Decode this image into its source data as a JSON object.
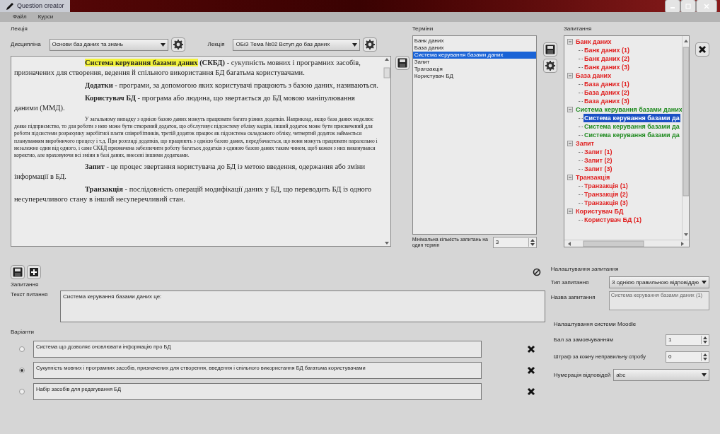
{
  "window": {
    "title": "Question creator"
  },
  "menu": [
    "Файл",
    "Курси"
  ],
  "lecture": {
    "title": "Лекція",
    "discipline_label": "Дисципліна",
    "discipline": "Основи баз даних та знань",
    "lecture_label": "Лекція",
    "lecture": "ОБіЗ Тема №02 Вступ до баз даних"
  },
  "editor": {
    "paragraphs": [
      {
        "kind": "term",
        "term": "Система керування базами даних",
        "highlight": true,
        "text": "**(СКБД)** - сукупність мовних і програмних засобів, призначених для створення, ведення й спільного використання БД багатьма користувачами."
      },
      {
        "kind": "term",
        "term": "Додатки",
        "highlight": false,
        "text": " - програми, за допомогою яких користувачі працюють з базою даних, називаються."
      },
      {
        "kind": "term",
        "term": "Користувач БД",
        "highlight": false,
        "text": " - програма або людина, що звертається до БД мовою маніпулювання даними (ММД)."
      },
      {
        "kind": "small",
        "text": "У загальному випадку з однією базою даних можуть працювати багато різних додатків. Наприклад, якщо база даних моделює деяке підприємство, то для роботи з нею може бути створений додаток, що обслуговує підсистему обліку кадрів, інший додаток може бути присвячений для роботи підсистеми розрахунку заробітної плати співробітників, третій додаток працює як підсистема складського обліку, четвертий додаток займається плануванням виробничого процесу і т.д. При розгляді додатків, що працюють з однією базою даних, передбачається, що вони можуть працювати паралельно і незалежно один від одного, і саме СКБД призначена забезпечити роботу багатьох додатків з єдиною базою даних таким чином, щоб кожен з них виконувався коректно, але враховуючи всі зміни в базі даних, внесені іншими додатками."
      },
      {
        "kind": "term",
        "term": "Запит",
        "highlight": false,
        "text": " - це процес звертання користувача до БД із метою введення, одержання або зміни інформації в БД."
      },
      {
        "kind": "term",
        "term": "Транзакція",
        "highlight": false,
        "text": " - послідовність операцій модифікації даних у БД, що переводить БД із одного несуперечливого стану в інший несуперечливий стан."
      }
    ]
  },
  "terms": {
    "title": "Терміни",
    "items": [
      {
        "label": "Банк даних",
        "selected": false
      },
      {
        "label": "База даних",
        "selected": false
      },
      {
        "label": "Система керування базами даних",
        "selected": true
      },
      {
        "label": "Запит",
        "selected": false
      },
      {
        "label": "Транзакція",
        "selected": false
      },
      {
        "label": "Користувач БД",
        "selected": false
      }
    ],
    "min_label": "Мінімальна кількість запитань на один термін",
    "min_value": "3"
  },
  "questions_tree": {
    "title": "Запитання",
    "items": [
      {
        "label": "Банк даних",
        "color": "#e02020",
        "selected": false,
        "children": [
          {
            "label": "Банк даних (1)",
            "color": "#e02020",
            "selected": false
          },
          {
            "label": "Банк даних (2)",
            "color": "#e02020",
            "selected": false
          },
          {
            "label": "Банк даних (3)",
            "color": "#e02020",
            "selected": false
          }
        ]
      },
      {
        "label": "База даних",
        "color": "#e02020",
        "selected": false,
        "children": [
          {
            "label": "База даних (1)",
            "color": "#e02020",
            "selected": false
          },
          {
            "label": "База даних (2)",
            "color": "#e02020",
            "selected": false
          },
          {
            "label": "База даних (3)",
            "color": "#e02020",
            "selected": false
          }
        ]
      },
      {
        "label": "Система керування базами даних",
        "color": "#1e8a1e",
        "selected": false,
        "children": [
          {
            "label": "Система керування базами да",
            "selected": true
          },
          {
            "label": "Система керування базами да",
            "color": "#1e8a1e",
            "selected": false
          },
          {
            "label": "Система керування базами да",
            "color": "#1e8a1e",
            "selected": false
          }
        ]
      },
      {
        "label": "Запит",
        "color": "#e02020",
        "selected": false,
        "children": [
          {
            "label": "Запит (1)",
            "color": "#e02020",
            "selected": false
          },
          {
            "label": "Запит (2)",
            "color": "#e02020",
            "selected": false
          },
          {
            "label": "Запит (3)",
            "color": "#e02020",
            "selected": false
          }
        ]
      },
      {
        "label": "Транзакція",
        "color": "#e02020",
        "selected": false,
        "children": [
          {
            "label": "Транзакція (1)",
            "color": "#e02020",
            "selected": false
          },
          {
            "label": "Транзакція (2)",
            "color": "#e02020",
            "selected": false
          },
          {
            "label": "Транзакція (3)",
            "color": "#e02020",
            "selected": false
          }
        ]
      },
      {
        "label": "Користувач БД",
        "color": "#e02020",
        "selected": false,
        "children": [
          {
            "label": "Користувач БД (1)",
            "color": "#e02020",
            "selected": false
          }
        ]
      }
    ]
  },
  "question": {
    "title": "Запитання",
    "text_label": "Текст питання",
    "text": "Система керування базами даних це:"
  },
  "answers": {
    "title": "Варіанти",
    "items": [
      {
        "text": "Система що дозволяє оновлювати інформацію про БД",
        "selected": false
      },
      {
        "text": "Сукупність мовних і програмних засобів, призначених для створення, введення і спільного використання БД багатьма користувачами",
        "selected": true
      },
      {
        "text": "Набір засобів для редагування БД",
        "selected": false
      }
    ]
  },
  "settings": {
    "title": "Налаштування запитання",
    "type_label": "Тип запитання",
    "type": "З однією правильною відповіддю",
    "name_label": "Назва запитання",
    "name": "Система керування базами даних (1)",
    "moodle_title": "Налаштування системи Moodle",
    "grade_label": "Бал за замовчуванням",
    "grade": "1",
    "penalty_label": "Штраф за кожну неправильну спробу",
    "penalty": "0",
    "numbering_label": "Нумерація відповідей",
    "numbering": "abc"
  }
}
